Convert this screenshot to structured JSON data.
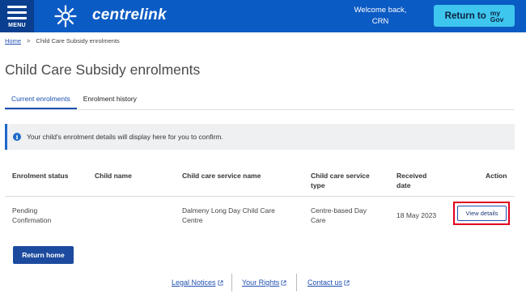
{
  "header": {
    "menu_label": "MENU",
    "logo_text": "centrelink",
    "welcome_line1": "Welcome back,",
    "welcome_line2": "CRN",
    "return_label": "Return to",
    "mygov_my": "my",
    "mygov_gov": "Gov",
    "brand_color": "#0b5bc4",
    "accent_color": "#3ec6ee"
  },
  "breadcrumb": {
    "home": "Home",
    "separator": ">",
    "current": "Child Care Subsidy enrolments"
  },
  "page_title": "Child Care Subsidy enrolments",
  "tabs": [
    {
      "label": "Current enrolments",
      "active": true
    },
    {
      "label": "Enrolment history",
      "active": false
    }
  ],
  "info": {
    "icon": "info-icon",
    "text": "Your child's enrolment details will display here for you to confirm."
  },
  "table": {
    "headers": {
      "status": "Enrolment status",
      "child": "Child name",
      "service": "Child care service name",
      "type_line1": "Child care service",
      "type_line2": "type",
      "received_line1": "Received",
      "received_line2": "date",
      "action": "Action"
    },
    "row": {
      "status_line1": "Pending",
      "status_line2": "Confirmation",
      "child": "",
      "service_line1": "Dalmeny Long Day Child Care",
      "service_line2": "Centre",
      "type_line1": "Centre-based Day",
      "type_line2": "Care",
      "received": "18 May 2023",
      "action_label": "View details"
    }
  },
  "return_home_label": "Return home",
  "footer": {
    "legal": "Legal Notices",
    "rights": "Your Rights",
    "contact": "Contact us"
  }
}
